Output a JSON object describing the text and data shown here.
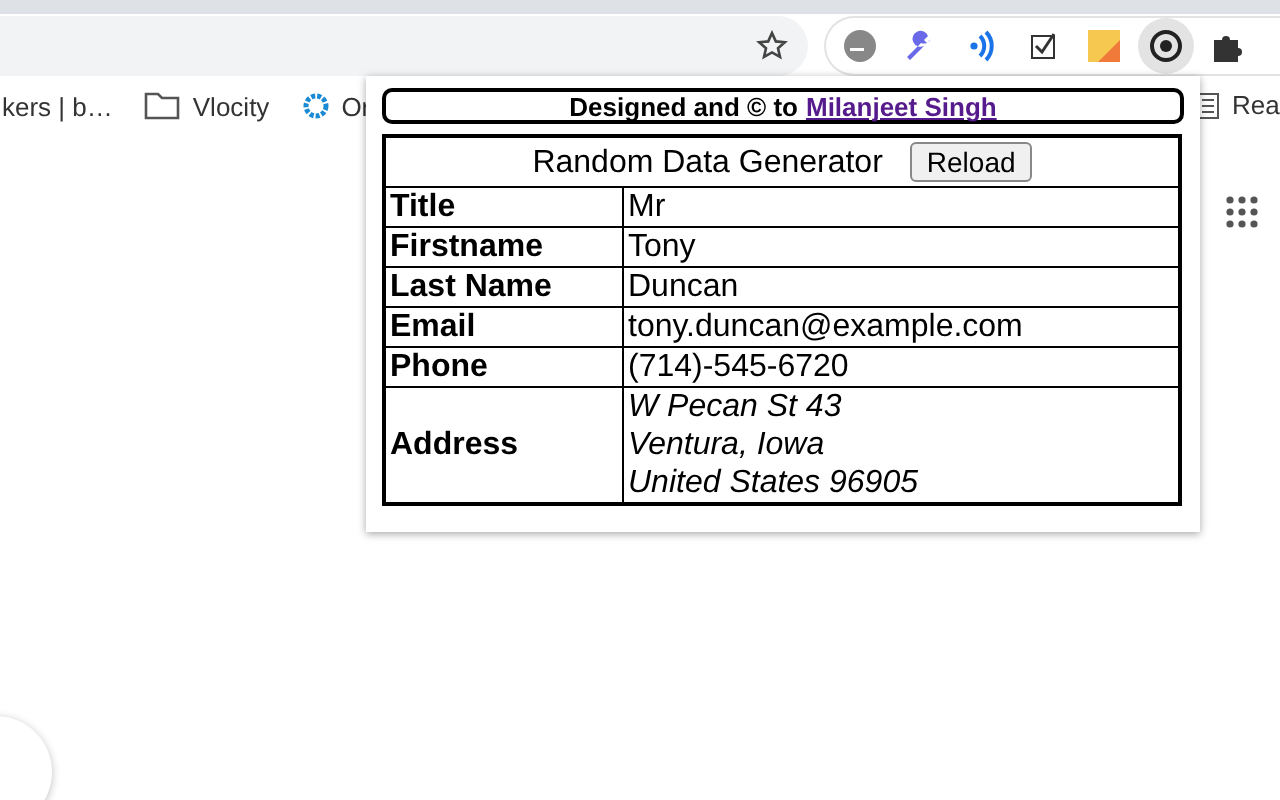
{
  "bookmarks": [
    {
      "kind": "page",
      "label": "kers | b…"
    },
    {
      "kind": "folder",
      "label": "Vlocity"
    },
    {
      "kind": "site",
      "label": "Or"
    }
  ],
  "reading_list": {
    "label": "Rea"
  },
  "popup": {
    "credit": {
      "text": "Designed and © to",
      "link": "Milanjeet Singh"
    },
    "heading": "Random Data Generator",
    "reload_button": "Reload",
    "rows": [
      {
        "kind": "plain",
        "label": "Title",
        "value": [
          "Mr"
        ]
      },
      {
        "kind": "plain",
        "label": "Firstname",
        "value": [
          "Tony"
        ]
      },
      {
        "kind": "plain",
        "label": "Last Name",
        "value": [
          "Duncan"
        ]
      },
      {
        "kind": "plain",
        "label": "Email",
        "value": [
          "tony.duncan@example.com"
        ]
      },
      {
        "kind": "plain",
        "label": "Phone",
        "value": [
          "(714)-545-6720"
        ]
      },
      {
        "kind": "address",
        "label": "Address",
        "value": [
          "W Pecan St 43",
          "Ventura, Iowa",
          "United States 96905"
        ]
      }
    ]
  }
}
